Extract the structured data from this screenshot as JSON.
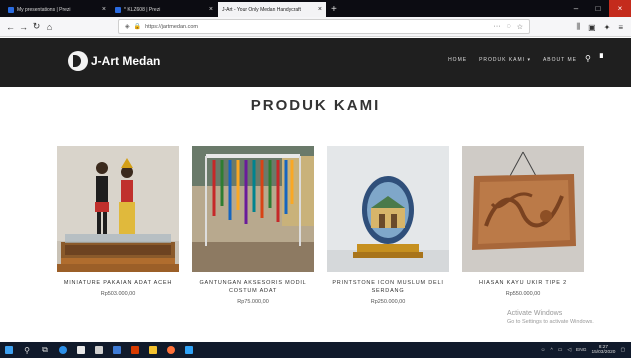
{
  "browser": {
    "tabs": [
      {
        "title": "My presentations | Prezi",
        "active": false
      },
      {
        "title": "* KLZ608 | Prezi",
        "active": false
      },
      {
        "title": "J-Art - Your Only Medan Handycraft",
        "active": true
      }
    ],
    "url": "https://jartmedan.com",
    "icons": {
      "back": "back-arrow-icon",
      "forward": "forward-arrow-icon",
      "reload": "reload-icon",
      "home": "home-icon",
      "lock": "lock-icon",
      "bookmark": "star-icon",
      "library": "library-icon",
      "menu": "hamburger-icon"
    }
  },
  "site": {
    "logo_text": "J-Art Medan",
    "nav": {
      "home": "HOME",
      "produk": "PRODUK KAMI ▾",
      "about": "ABOUT ME"
    }
  },
  "section": {
    "title": "PRODUK KAMI"
  },
  "products": [
    {
      "name": "MINIATURE PAKAIAN ADAT ACEH",
      "price": "Rp503.000,00"
    },
    {
      "name": "GANTUNGAN AKSESORIS MODIL COSTUM ADAT",
      "price": "Rp75.000,00"
    },
    {
      "name": "PRINTSTONE ICON MUSLUM DELI SERDANG",
      "price": "Rp250.000,00"
    },
    {
      "name": "HIASAN KAYU UKIR TIPE 2",
      "price": "Rp550.000,00"
    }
  ],
  "watermark": {
    "line1": "Activate Windows",
    "line2": "Go to Settings to activate Windows."
  },
  "taskbar": {
    "tray_text": "ENG",
    "time": "8:27",
    "date": "15/03/2020"
  },
  "colors": {
    "header_bg": "#1f1f1f",
    "taskbar_bg": "#101a2b",
    "close_red": "#c42b1c"
  }
}
